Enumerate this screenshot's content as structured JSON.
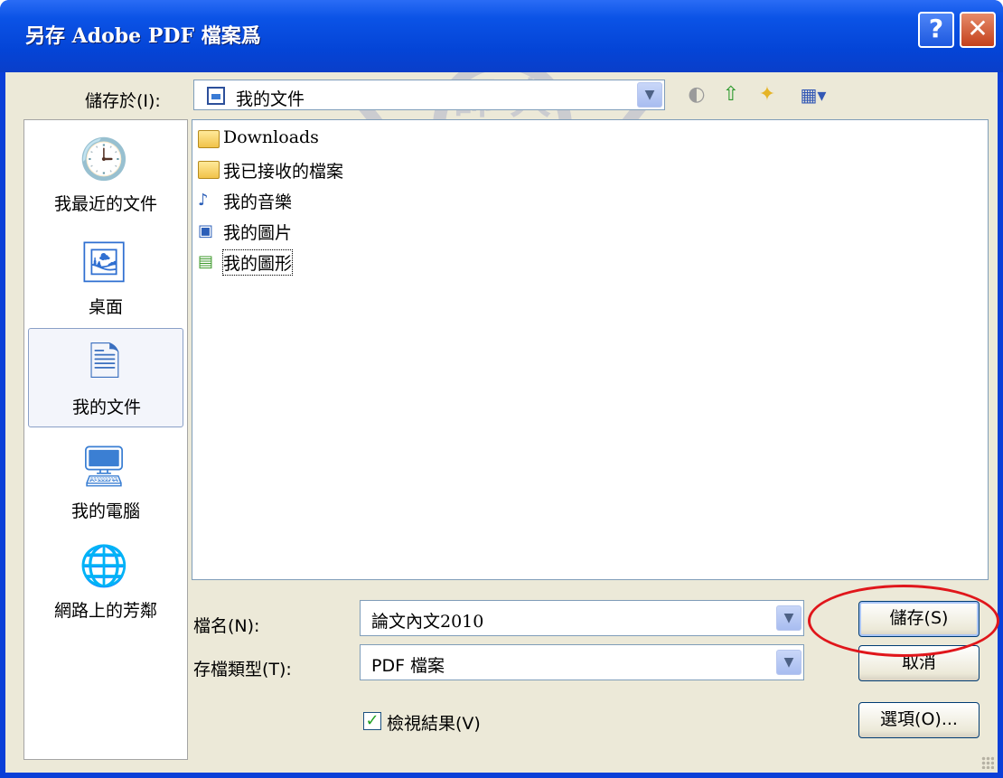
{
  "window": {
    "title": "另存 Adobe PDF 檔案爲",
    "help_glyph": "?",
    "close_glyph": "✕"
  },
  "watermark": {
    "text": "師 大"
  },
  "toolbar": {
    "save_in_label": "儲存於(I):",
    "save_in_value": "我的文件",
    "icons": [
      "back-icon",
      "up-folder-icon",
      "new-folder-icon",
      "views-menu-icon"
    ]
  },
  "places": [
    {
      "label": "我最近的文件",
      "icon": "recent-documents-icon",
      "selected": false
    },
    {
      "label": "桌面",
      "icon": "desktop-icon",
      "selected": false
    },
    {
      "label": "我的文件",
      "icon": "my-documents-icon",
      "selected": true
    },
    {
      "label": "我的電腦",
      "icon": "my-computer-icon",
      "selected": false
    },
    {
      "label": "網路上的芳鄰",
      "icon": "network-places-icon",
      "selected": false
    }
  ],
  "files": [
    {
      "name": "Downloads",
      "icon": "folder-icon"
    },
    {
      "name": "我已接收的檔案",
      "icon": "folder-icon"
    },
    {
      "name": "我的音樂",
      "icon": "music-folder-icon"
    },
    {
      "name": "我的圖片",
      "icon": "pictures-folder-icon"
    },
    {
      "name": "我的圖形",
      "icon": "graphics-folder-icon"
    }
  ],
  "form": {
    "filename_label": "檔名(N):",
    "filename_value": "論文內文2010",
    "filetype_label": "存檔類型(T):",
    "filetype_value": "PDF 檔案",
    "view_result_label": "檢視結果(V)",
    "view_result_checked": true
  },
  "buttons": {
    "save": "儲存(S)",
    "cancel": "取消",
    "options": "選項(O)..."
  },
  "colors": {
    "titlebar": "#0a4fe0",
    "annotation_oval": "#e0161b"
  }
}
